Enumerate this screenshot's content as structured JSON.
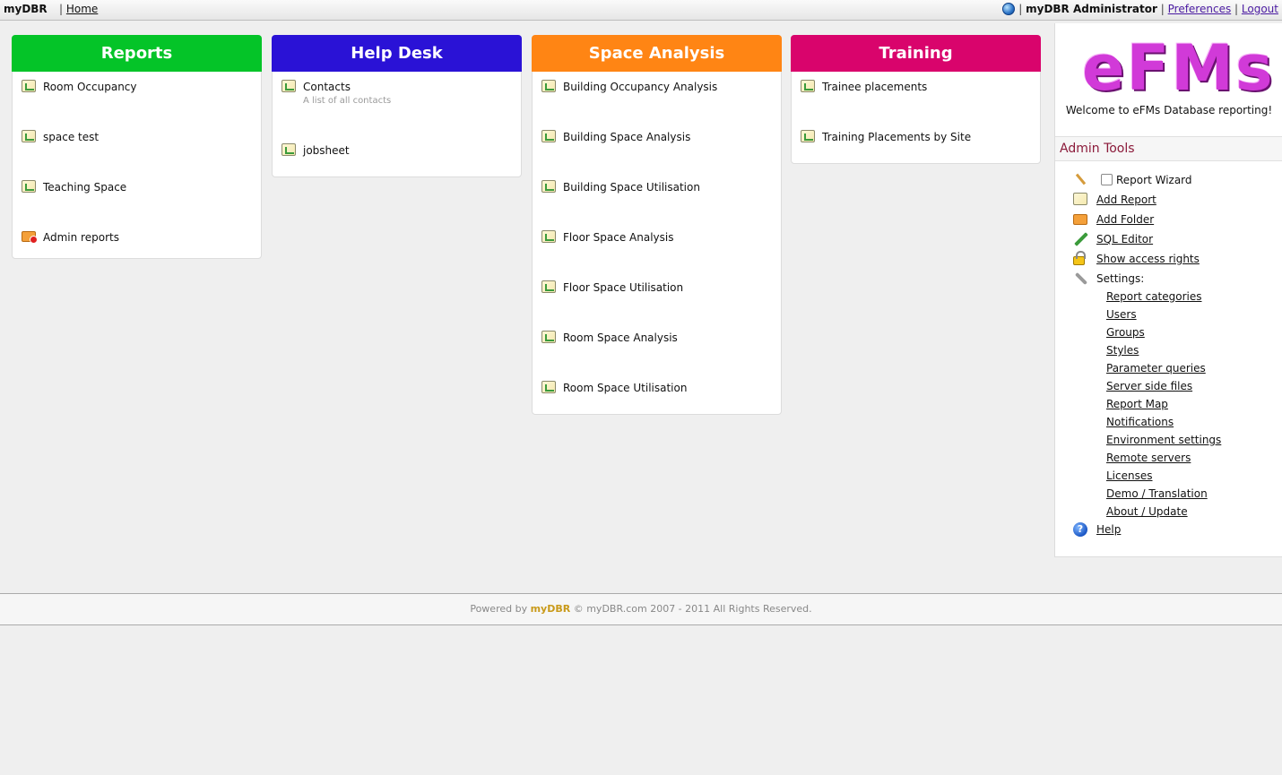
{
  "topbar": {
    "brand": "myDBR",
    "separator": "|",
    "home_link": "Home",
    "admin_name": "myDBR Administrator",
    "preferences_link": "Preferences",
    "logout_link": "Logout"
  },
  "categories": [
    {
      "title": "Reports",
      "color": "#04c428",
      "items": [
        {
          "label": "Room Occupancy",
          "icon": "report-icon"
        },
        {
          "label": "space test",
          "icon": "report-icon"
        },
        {
          "label": "Teaching Space",
          "icon": "report-icon"
        },
        {
          "label": "Admin reports",
          "icon": "folder-icon"
        }
      ]
    },
    {
      "title": "Help Desk",
      "color": "#2a12d6",
      "items": [
        {
          "label": "Contacts",
          "desc": "A list of all contacts",
          "icon": "report-icon"
        },
        {
          "label": "jobsheet",
          "icon": "report-icon"
        }
      ]
    },
    {
      "title": "Space Analysis",
      "color": "#ff8514",
      "items": [
        {
          "label": "Building Occupancy Analysis",
          "icon": "report-icon"
        },
        {
          "label": "Building Space Analysis",
          "icon": "report-icon"
        },
        {
          "label": "Building Space Utilisation",
          "icon": "report-icon"
        },
        {
          "label": "Floor Space Analysis",
          "icon": "report-icon"
        },
        {
          "label": "Floor Space Utilisation",
          "icon": "report-icon"
        },
        {
          "label": "Room Space Analysis",
          "icon": "report-icon"
        },
        {
          "label": "Room Space Utilisation",
          "icon": "report-icon"
        }
      ]
    },
    {
      "title": "Training",
      "color": "#d9046c",
      "items": [
        {
          "label": "Trainee placements",
          "icon": "report-icon"
        },
        {
          "label": "Training Placements by Site",
          "icon": "report-icon"
        }
      ]
    }
  ],
  "sidebar": {
    "logo_text": "eFMs",
    "welcome": "Welcome to eFMs Database reporting!",
    "admin_tools_title": "Admin Tools",
    "report_wizard": "Report Wizard",
    "add_report": "Add Report",
    "add_folder": "Add Folder",
    "sql_editor": "SQL Editor",
    "show_access_rights": "Show access rights",
    "settings_label": "Settings:",
    "settings": [
      "Report categories",
      "Users",
      "Groups",
      "Styles",
      "Parameter queries",
      "Server side files",
      "Report Map",
      "Notifications",
      "Environment settings",
      "Remote servers",
      "Licenses",
      "Demo / Translation",
      "About / Update"
    ],
    "help": "Help"
  },
  "footer": {
    "powered_by": "Powered by",
    "brand": "myDBR",
    "rest": "© myDBR.com 2007 - 2011 All Rights Reserved."
  }
}
